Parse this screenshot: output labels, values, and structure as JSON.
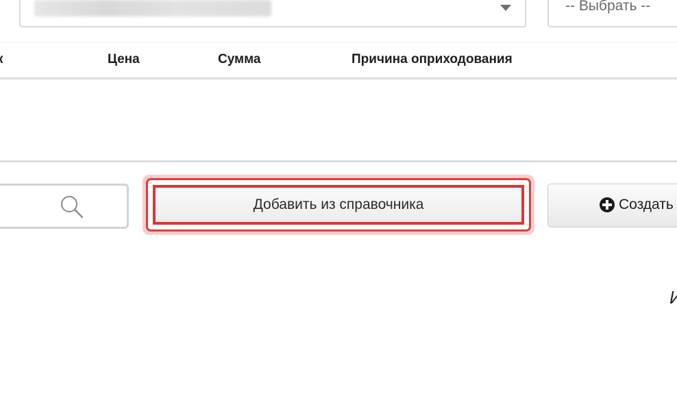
{
  "select": {
    "value_blurred": "",
    "choose_placeholder": "-- Выбрать --"
  },
  "table": {
    "columns": [
      "к",
      "Цена",
      "Сумма",
      "Причина оприходования"
    ],
    "rows": []
  },
  "search": {
    "value": ""
  },
  "actions": {
    "add_from_catalog": "Добавить из справочника",
    "create": "Создать"
  },
  "footer": {
    "cut_text": "И"
  },
  "colors": {
    "highlight": "#e23c3c",
    "border": "#d9d9d9"
  }
}
